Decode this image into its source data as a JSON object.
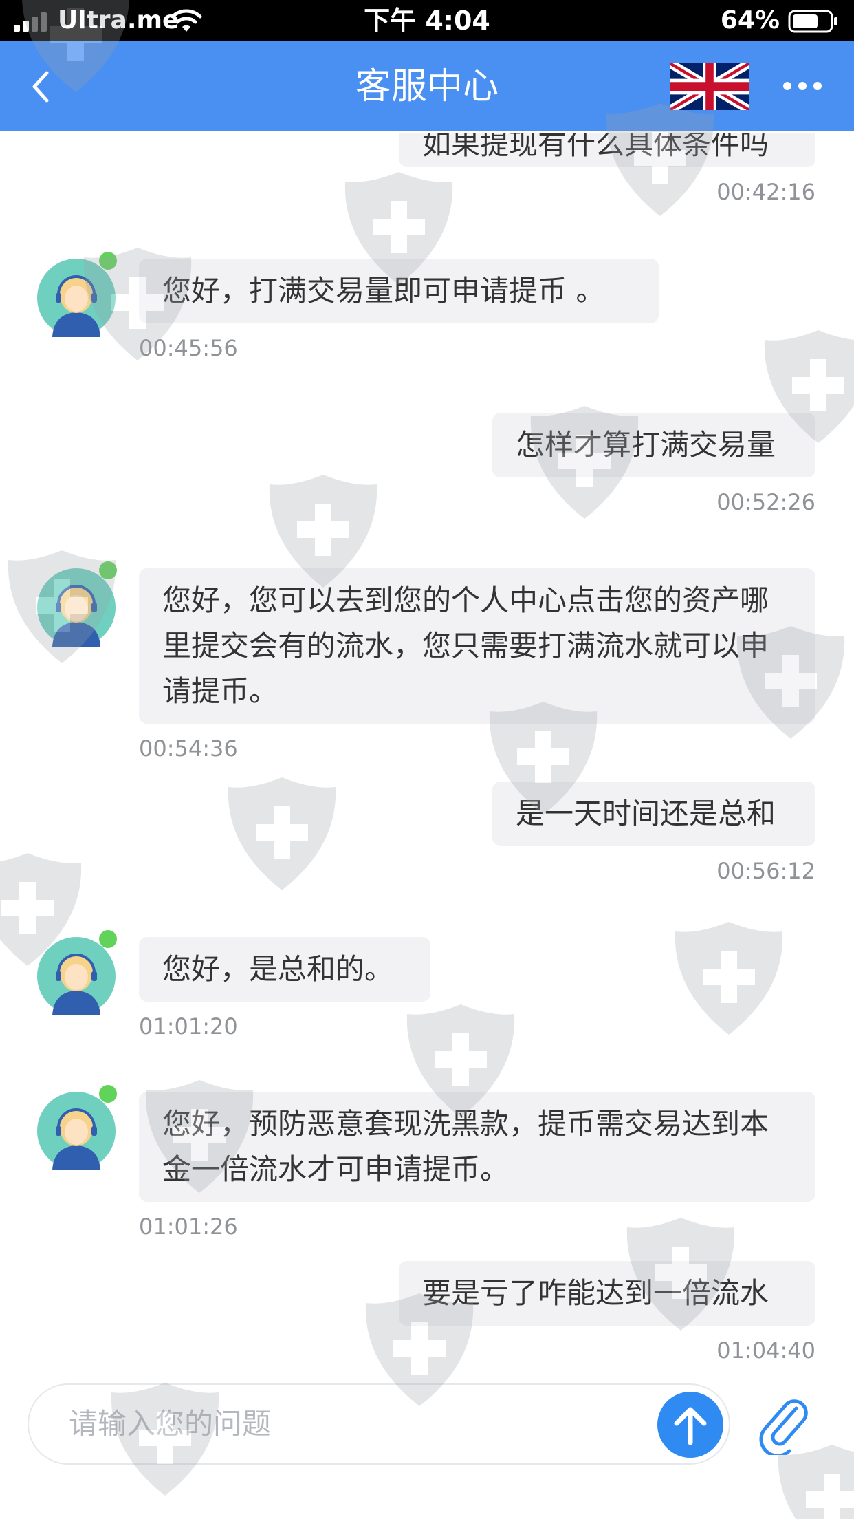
{
  "status_bar": {
    "carrier": "Ultra.me",
    "time": "下午 4:04",
    "battery_percent": "64%"
  },
  "nav": {
    "title": "客服中心",
    "language_icon": "uk-flag-icon",
    "more_icon": "more-dots-icon",
    "back_icon": "chevron-left-icon"
  },
  "messages": [
    {
      "side": "right",
      "text": "如果提现有什么具体条件吗",
      "time": "00:42:16"
    },
    {
      "side": "left",
      "text": "您好，打满交易量即可申请提币 。",
      "time": "00:45:56"
    },
    {
      "side": "right",
      "text": "怎样才算打满交易量",
      "time": "00:52:26"
    },
    {
      "side": "left",
      "text": "您好，您可以去到您的个人中心点击您的资产哪里提交会有的流水，您只需要打满流水就可以申请提币。",
      "time": "00:54:36"
    },
    {
      "side": "right",
      "text": "是一天时间还是总和",
      "time": "00:56:12"
    },
    {
      "side": "left",
      "text": "您好，是总和的。",
      "time": "01:01:20"
    },
    {
      "side": "left",
      "text": "您好，预防恶意套现洗黑款，提币需交易达到本金一倍流水才可申请提币。",
      "time": "01:01:26"
    },
    {
      "side": "right",
      "text": "要是亏了咋能达到一倍流水",
      "time": "01:04:40"
    }
  ],
  "input": {
    "placeholder": "请输入您的问题"
  },
  "colors": {
    "nav_bg": "#4a8ff2",
    "send_button": "#2f8bf1",
    "online_dot": "#62d35a",
    "bubble_bg": "#f2f2f4"
  }
}
